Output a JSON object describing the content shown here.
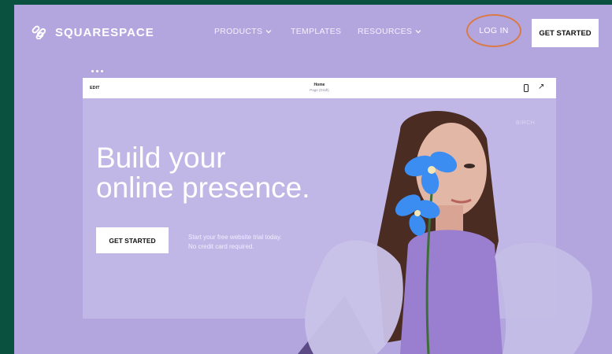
{
  "nav": {
    "logo_text": "SQUARESPACE",
    "products": "PRODUCTS",
    "templates": "TEMPLATES",
    "resources": "RESOURCES",
    "login": "LOG IN",
    "get_started": "GET STARTED"
  },
  "editor": {
    "edit_label": "EDIT",
    "page_title": "Home",
    "page_sub": "Page (Draft)",
    "brand": "BIRCH"
  },
  "hero": {
    "title_line1": "Build your",
    "title_line2": "online presence.",
    "cta": "GET STARTED",
    "note_line1": "Start your free website trial today.",
    "note_line2": "No credit card required."
  },
  "colors": {
    "border": "#0b5140",
    "background": "#b3a6df",
    "login_highlight": "#d97a47"
  }
}
